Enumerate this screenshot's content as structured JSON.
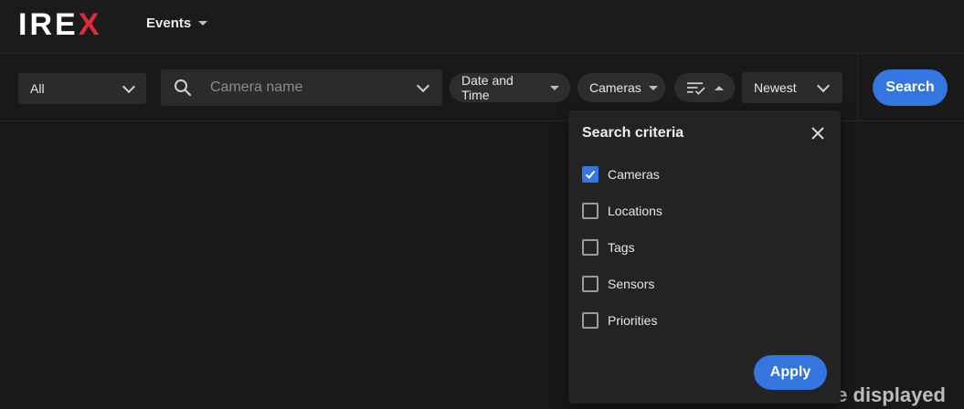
{
  "app": {
    "logo_text": "IREX",
    "logo_accent_color": "#e02b3a"
  },
  "nav": {
    "events_label": "Events"
  },
  "toolbar": {
    "scope_select": "All",
    "camera_search_placeholder": "Camera name",
    "date_time_chip": "Date and Time",
    "cameras_chip": "Cameras",
    "sort_select": "Newest",
    "search_button": "Search"
  },
  "background_message": "e displayed",
  "search_criteria_popup": {
    "title": "Search criteria",
    "options": [
      {
        "label": "Cameras",
        "checked": true
      },
      {
        "label": "Locations",
        "checked": false
      },
      {
        "label": "Tags",
        "checked": false
      },
      {
        "label": "Sensors",
        "checked": false
      },
      {
        "label": "Priorities",
        "checked": false
      }
    ],
    "apply_button": "Apply"
  },
  "colors": {
    "accent": "#3575e0",
    "background": "#191919"
  }
}
